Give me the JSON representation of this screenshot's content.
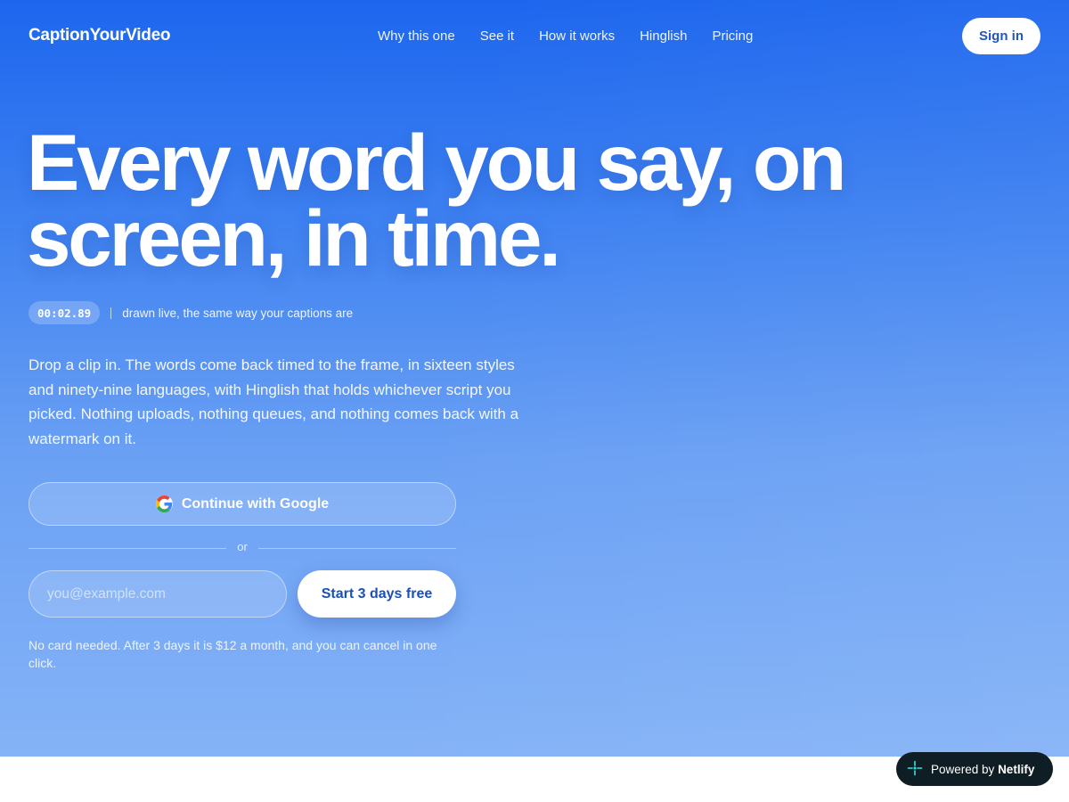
{
  "header": {
    "brand": "CaptionYourVideo",
    "nav": [
      "Why this one",
      "See it",
      "How it works",
      "Hinglish",
      "Pricing"
    ],
    "sign_in_label": "Sign in"
  },
  "hero": {
    "headline_line1": "Every word you say, on",
    "headline_line2": "screen, in time.",
    "timer_value": "00:02.89",
    "timer_note": "drawn live, the same way your captions are",
    "lede": "Drop a clip in. The words come back timed to the frame, in sixteen styles and ninety-nine languages, with Hinglish that holds whichever script you picked. Nothing uploads, nothing queues, and nothing comes back with a watermark on it."
  },
  "signup": {
    "google_label": "Continue with Google",
    "or_label": "or",
    "email_placeholder": "you@example.com",
    "email_value": "",
    "start_label": "Start 3 days free",
    "fineprint": "No card needed. After 3 days it is $12 a month, and you can cancel in one click."
  },
  "badge": {
    "prefix": "Powered by",
    "name": "Netlify"
  },
  "colors": {
    "hero_top": "#1d66ee",
    "hero_bottom": "#85b3f7",
    "button_text": "#1b4fb8",
    "badge_bg": "#0f1d24"
  },
  "icons": [
    "google-icon",
    "netlify-icon"
  ]
}
